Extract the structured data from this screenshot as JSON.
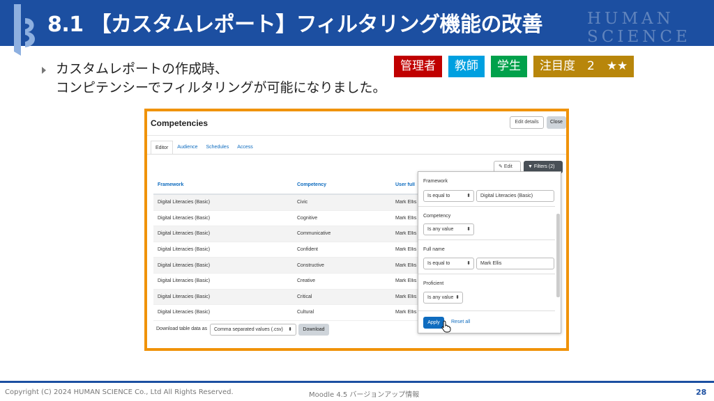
{
  "slide": {
    "title": "8.1 【カスタムレポート】フィルタリング機能の改善",
    "brand_line1": "HUMAN",
    "brand_line2": "SCIENCE",
    "body_line1": "カスタムレポートの作成時、",
    "body_line2": "コンピテンシーでフィルタリングが可能になりました。",
    "tags": [
      {
        "label": "管理者",
        "color": "#c00000"
      },
      {
        "label": "教師",
        "color": "#00a0e0"
      },
      {
        "label": "学生",
        "color": "#00a14b"
      },
      {
        "label": "注目度　2　★★",
        "color": "#b8860b"
      }
    ]
  },
  "report": {
    "title": "Competencies",
    "edit_details": "Edit details",
    "close": "Close",
    "tabs": [
      "Editor",
      "Audience",
      "Schedules",
      "Access"
    ],
    "edit": "Edit",
    "filters": "Filters (2)",
    "columns": [
      "Framework",
      "Competency",
      "User full"
    ],
    "rows": [
      [
        "Digital Literacies (Basic)",
        "Civic",
        "Mark Ellis"
      ],
      [
        "Digital Literacies (Basic)",
        "Cognitive",
        "Mark Ellis"
      ],
      [
        "Digital Literacies (Basic)",
        "Communicative",
        "Mark Ellis"
      ],
      [
        "Digital Literacies (Basic)",
        "Confident",
        "Mark Ellis"
      ],
      [
        "Digital Literacies (Basic)",
        "Constructive",
        "Mark Ellis"
      ],
      [
        "Digital Literacies (Basic)",
        "Creative",
        "Mark Ellis"
      ],
      [
        "Digital Literacies (Basic)",
        "Critical",
        "Mark Ellis"
      ],
      [
        "Digital Literacies (Basic)",
        "Cultural",
        "Mark Ellis"
      ]
    ],
    "download_label": "Download table data as",
    "download_format": "Comma separated values (.csv)",
    "download_button": "Download"
  },
  "filters_panel": {
    "framework_label": "Framework",
    "framework_op": "Is equal to",
    "framework_value": "Digital Literacies (Basic)",
    "competency_label": "Competency",
    "competency_op": "Is any value",
    "fullname_label": "Full name",
    "fullname_op": "Is equal to",
    "fullname_value": "Mark Ellis",
    "proficient_label": "Proficient",
    "proficient_op": "Is any value",
    "apply": "Apply",
    "reset": "Reset all"
  },
  "footer": {
    "copyright": "Copyright (C) 2024 HUMAN SCIENCE Co., Ltd All Rights Reserved.",
    "center": "Moodle 4.5 バージョンアップ情報",
    "page": "28"
  }
}
